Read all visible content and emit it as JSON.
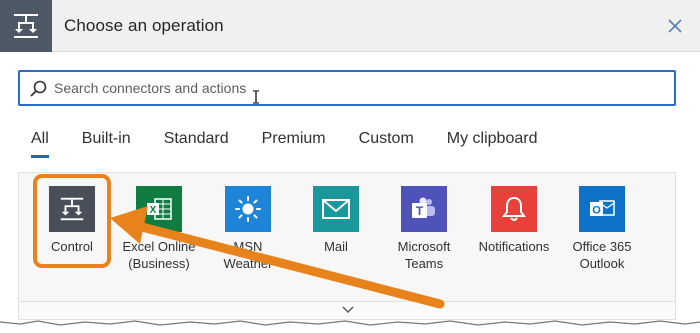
{
  "dialog": {
    "title": "Choose an operation",
    "header_icon": "control-icon",
    "close_icon": "close-icon"
  },
  "search": {
    "placeholder": "Search connectors and actions",
    "value": ""
  },
  "tabs": [
    {
      "label": "All",
      "active": true
    },
    {
      "label": "Built-in",
      "active": false
    },
    {
      "label": "Standard",
      "active": false
    },
    {
      "label": "Premium",
      "active": false
    },
    {
      "label": "Custom",
      "active": false
    },
    {
      "label": "My clipboard",
      "active": false
    }
  ],
  "connectors": [
    {
      "line1": "Control",
      "line2": "",
      "icon": "control-icon",
      "color": "#484f58"
    },
    {
      "line1": "Excel Online",
      "line2": "(Business)",
      "icon": "excel-icon",
      "color": "#107c41"
    },
    {
      "line1": "MSN",
      "line2": "Weather",
      "icon": "sun-icon",
      "color": "#1d84d8"
    },
    {
      "line1": "Mail",
      "line2": "",
      "icon": "mail-icon",
      "color": "#19979b"
    },
    {
      "line1": "Microsoft",
      "line2": "Teams",
      "icon": "teams-icon",
      "color": "#4f53b9"
    },
    {
      "line1": "Notifications",
      "line2": "",
      "icon": "bell-icon",
      "color": "#e8403a"
    },
    {
      "line1": "Office 365",
      "line2": "Outlook",
      "icon": "outlook-icon",
      "color": "#0d72c8"
    }
  ],
  "colors": {
    "accent": "#0f6cbd",
    "highlight": "#e8831c",
    "header_bg": "#f0f0f0"
  }
}
